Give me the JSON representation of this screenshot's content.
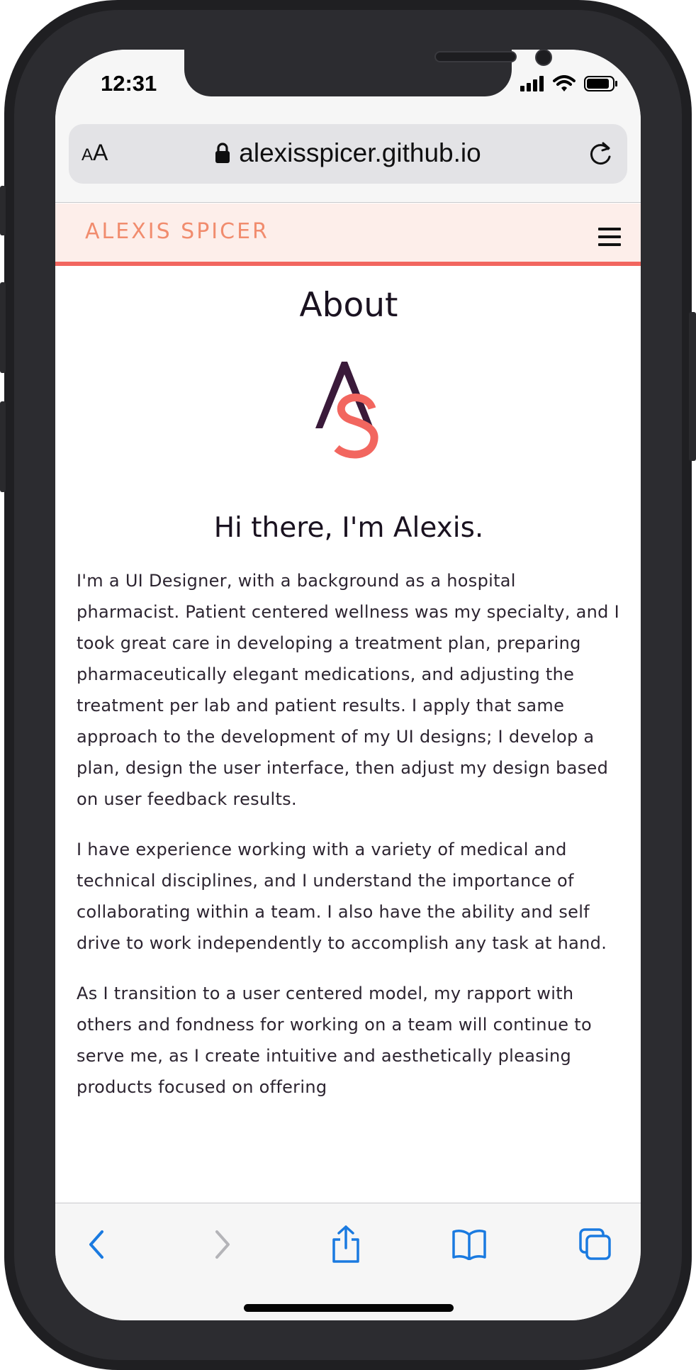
{
  "status_bar": {
    "time": "12:31"
  },
  "browser": {
    "text_size_button": {
      "small": "A",
      "big": "A"
    },
    "url": "alexisspicer.github.io",
    "accent_color": "#1a7ae0"
  },
  "site": {
    "logo_text": "ALEXIS SPICER",
    "brand_color": "#f18c6e",
    "header_bg": "#fdeeea",
    "accent_line": "#f2665f"
  },
  "page": {
    "title": "About",
    "monogram": {
      "letters": [
        "A",
        "S"
      ],
      "colors": [
        "#3a1a3a",
        "#f2665f"
      ]
    },
    "greeting": "Hi there, I'm Alexis.",
    "paragraphs": [
      "I'm a UI Designer, with a background as a hospital pharmacist. Patient centered wellness was my specialty, and I took great care in developing a treatment plan, preparing pharmaceutically elegant medications, and adjusting the treatment per lab and patient results. I apply that same approach to the development of my UI designs; I develop a plan, design the user interface, then adjust my design based on user feedback results.",
      "I have experience working with a variety of medical and technical disciplines, and I understand the importance of collaborating within a team. I also have the ability and self drive to work independently to accomplish any task at hand.",
      "As I transition to a user centered model, my rapport with others and fondness for working on a team will continue to serve me, as I create intuitive and aesthetically pleasing products focused on offering"
    ]
  },
  "toolbar": {
    "icons": [
      "back-icon",
      "forward-icon",
      "share-icon",
      "bookmarks-icon",
      "tabs-icon"
    ]
  }
}
